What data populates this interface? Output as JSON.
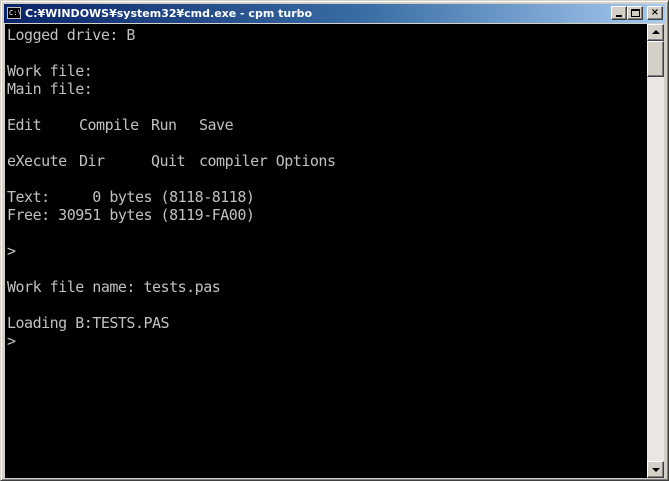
{
  "window": {
    "title": "C:¥WINDOWS¥system32¥cmd.exe - cpm turbo",
    "icon_label": "C:\\",
    "icon": "console-icon"
  },
  "caption_buttons": {
    "minimize": "minimize-icon",
    "maximize": "maximize-icon",
    "close_label": "×"
  },
  "console": {
    "logged_drive": "Logged drive: B",
    "work_file": "Work file:",
    "main_file": "Main file:",
    "menu_row1": [
      "Edit",
      "Compile",
      "Run",
      "Save"
    ],
    "menu_row2": [
      "eXecute",
      "Dir",
      "Quit",
      "compiler Options"
    ],
    "text_line": "Text:     0 bytes (8118-8118)",
    "free_line": "Free: 30951 bytes (8119-FA00)",
    "prompt1": ">",
    "work_file_name": "Work file name: tests.pas",
    "loading": "Loading B:TESTS.PAS",
    "prompt2": ">"
  },
  "colors": {
    "console_bg": "#000000",
    "console_text": "#c0c0c0",
    "titlebar_start": "#0a246a",
    "titlebar_end": "#a6caf0",
    "chrome": "#d4d0c8"
  }
}
